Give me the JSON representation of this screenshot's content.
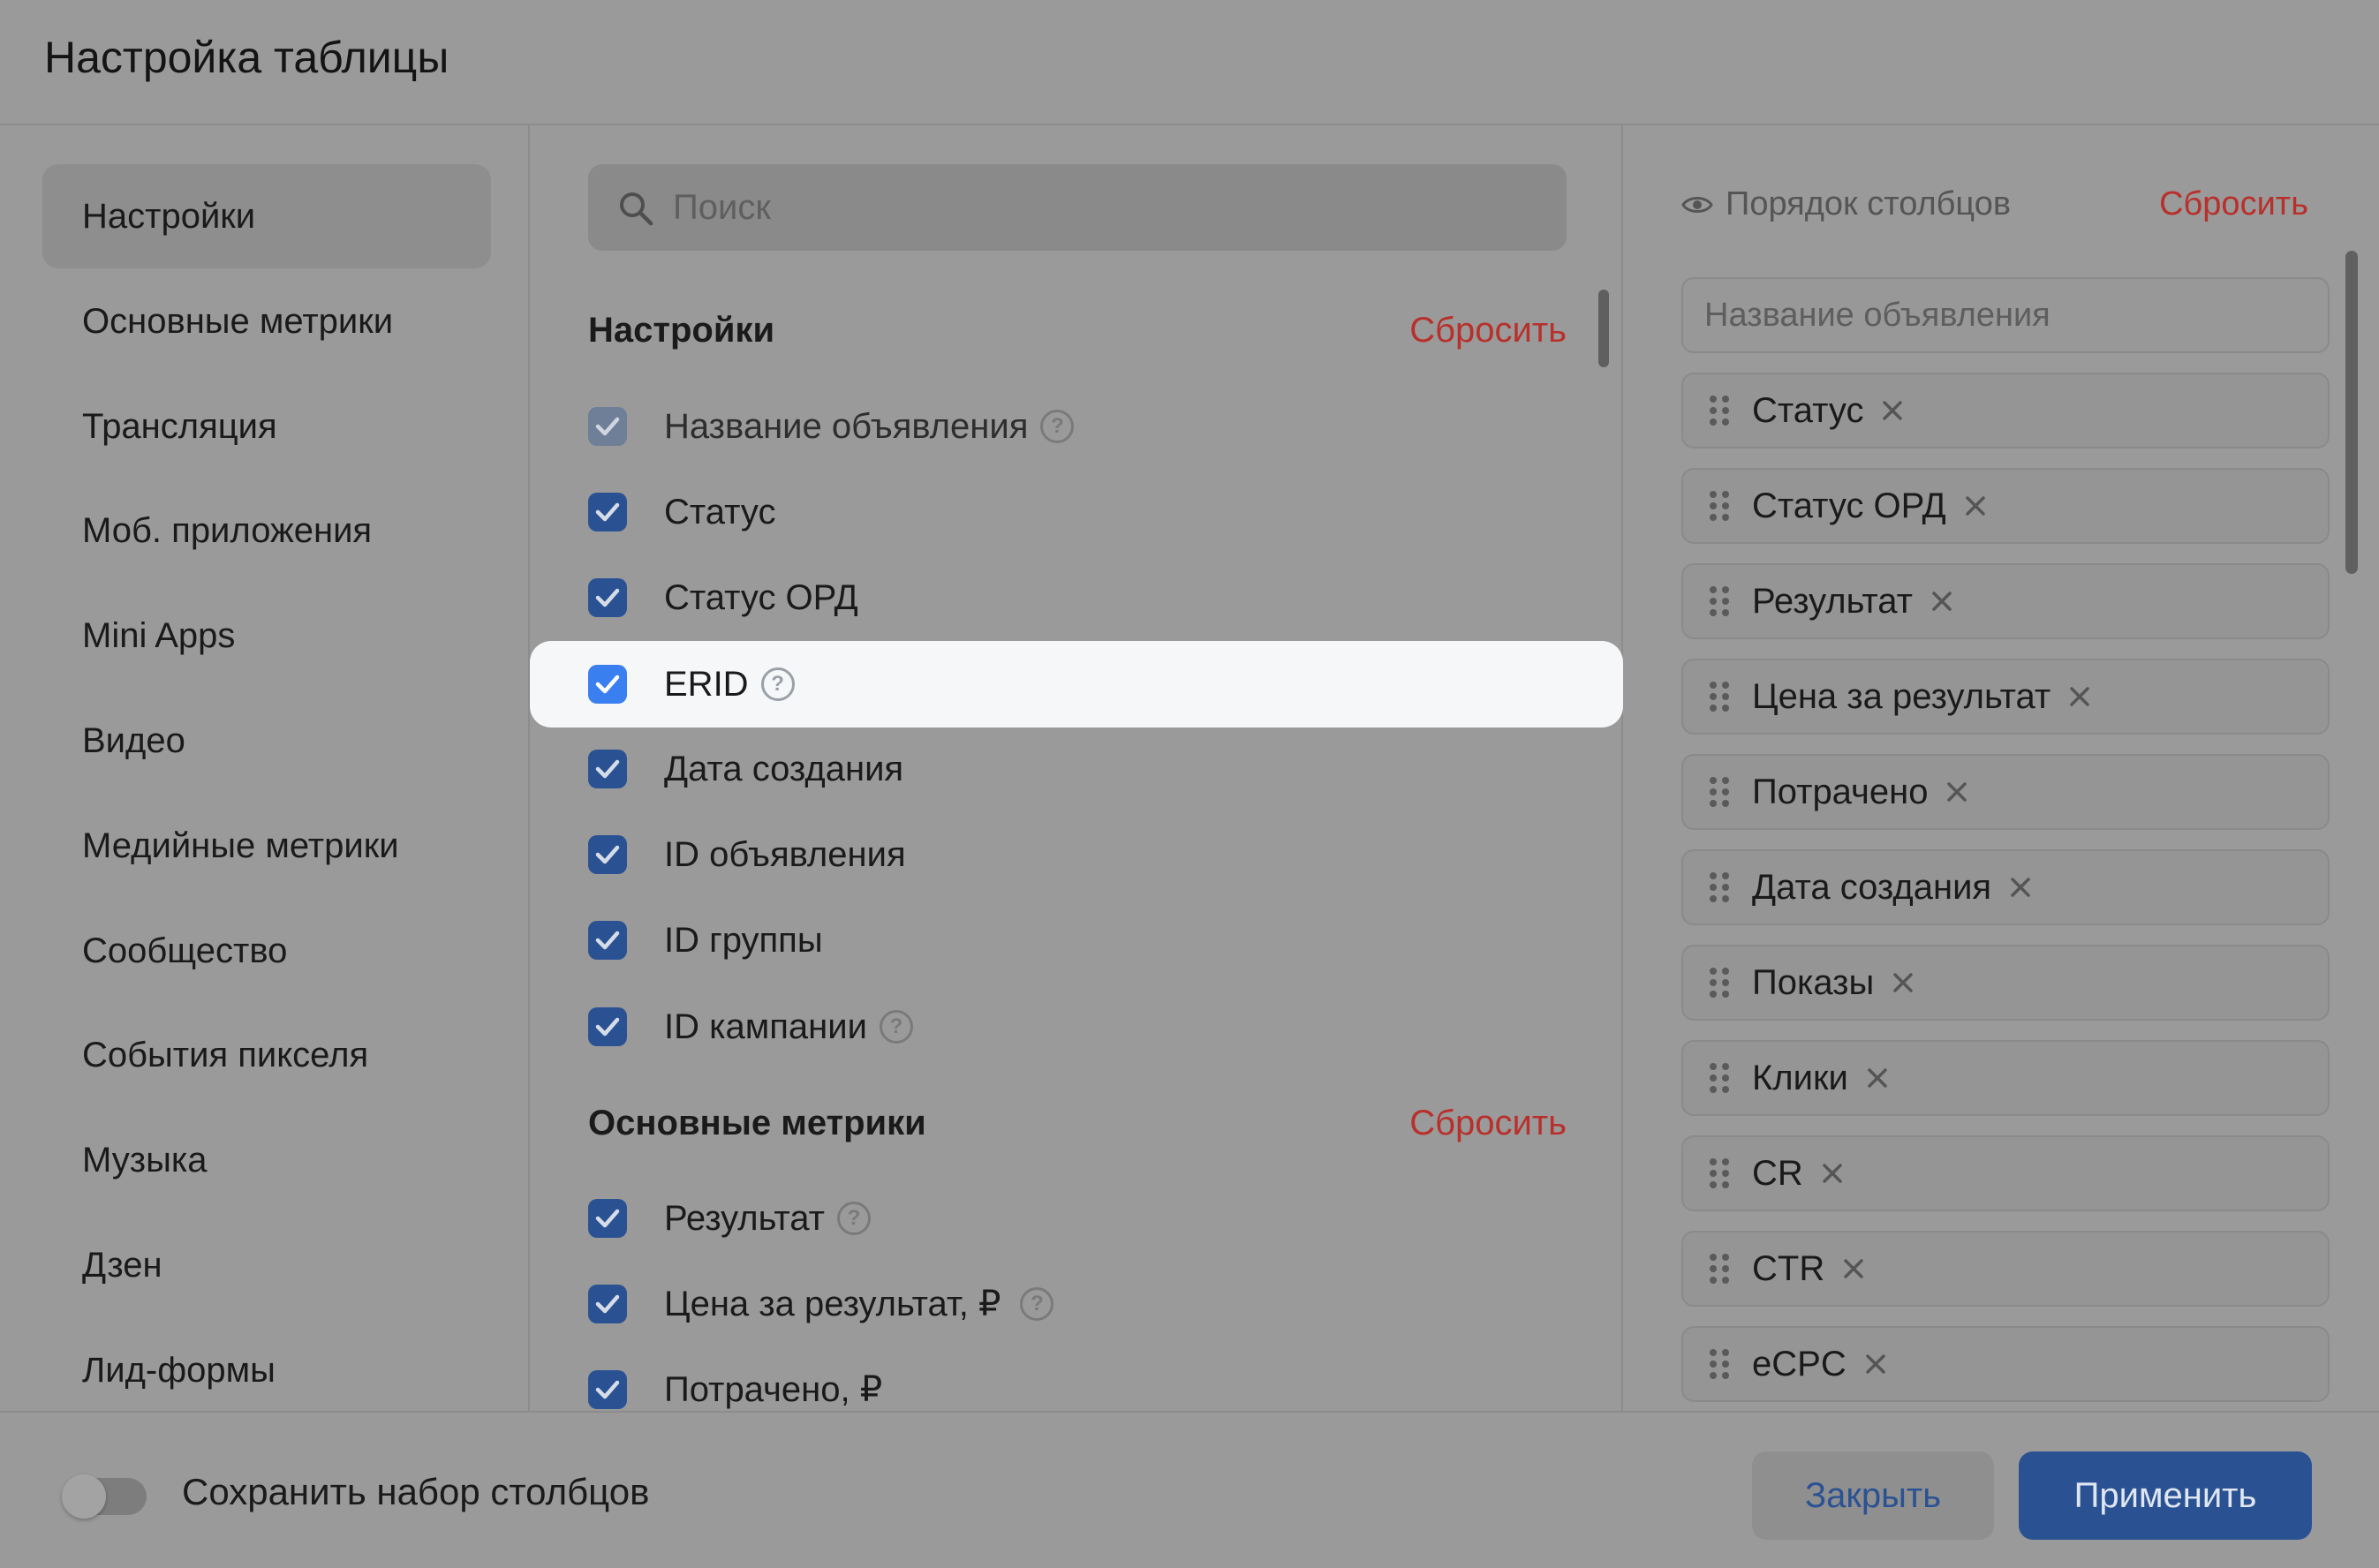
{
  "header": {
    "title": "Настройка таблицы"
  },
  "nav": {
    "items": [
      {
        "label": "Настройки",
        "active": true
      },
      {
        "label": "Основные метрики"
      },
      {
        "label": "Трансляция"
      },
      {
        "label": "Моб. приложения"
      },
      {
        "label": "Mini Apps"
      },
      {
        "label": "Видео"
      },
      {
        "label": "Медийные метрики"
      },
      {
        "label": "Сообщество"
      },
      {
        "label": "События пикселя"
      },
      {
        "label": "Музыка"
      },
      {
        "label": "Дзен"
      },
      {
        "label": "Лид-формы"
      }
    ]
  },
  "search": {
    "placeholder": "Поиск",
    "icon": "search-icon"
  },
  "sections": {
    "settings": {
      "label": "Настройки",
      "reset": "Сбросить",
      "items": [
        {
          "label": "Название объявления",
          "checked": true,
          "disabled": true,
          "help": true
        },
        {
          "label": "Статус",
          "checked": true
        },
        {
          "label": "Статус ОРД",
          "checked": true
        },
        {
          "label": "ERID",
          "checked": true,
          "help": true,
          "highlighted": true
        },
        {
          "label": "Дата создания",
          "checked": true
        },
        {
          "label": "ID объявления",
          "checked": true
        },
        {
          "label": "ID группы",
          "checked": true
        },
        {
          "label": "ID кампании",
          "checked": true,
          "help": true
        }
      ]
    },
    "main_metrics": {
      "label": "Основные метрики",
      "reset": "Сбросить",
      "items": [
        {
          "label": "Результат",
          "checked": true,
          "help": true
        },
        {
          "label": "Цена за результат, ₽",
          "checked": true,
          "help": true
        },
        {
          "label": "Потрачено, ₽",
          "checked": true
        }
      ]
    }
  },
  "help_glyph": "?",
  "column_order": {
    "label": "Порядок столбцов",
    "reset": "Сбросить",
    "fixed": "Название объявления",
    "items": [
      "Статус",
      "Статус ОРД",
      "Результат",
      "Цена за результат",
      "Потрачено",
      "Дата создания",
      "Показы",
      "Клики",
      "CR",
      "CTR",
      "eCPC"
    ]
  },
  "footer": {
    "toggle_label": "Сохранить набор столбцов",
    "toggle_on": false,
    "close": "Закрыть",
    "apply": "Применить"
  },
  "colors": {
    "accent": "#2a5293",
    "danger": "#b8302b",
    "highlight_row": "#f6f7f9",
    "checkbox_bright": "#3a7ff0"
  }
}
